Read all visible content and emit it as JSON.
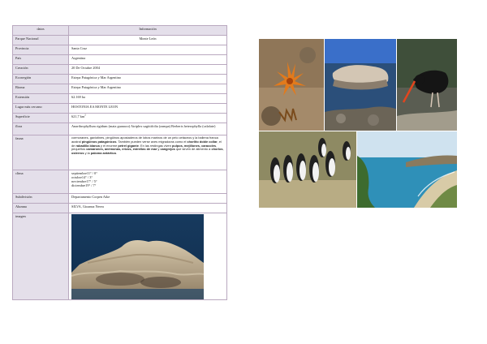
{
  "table": {
    "header": {
      "left": "datos",
      "right": "Información"
    },
    "rows": [
      {
        "key": "Parque Nacional",
        "value": "Monte León",
        "center": true
      },
      {
        "key": "Provincia",
        "value": "Santa Cruz"
      },
      {
        "key": "País",
        "value": "Argentina"
      },
      {
        "key": "Creación",
        "value": "20 De Octubre 2004"
      },
      {
        "key": "Ecorregión",
        "value": "Estepa Patagónica y Mar Argentino"
      },
      {
        "key": "Bioma",
        "value": "Estepa Patagónica y Mar Argentino"
      },
      {
        "key": "Extensión",
        "value": "62.169 ha"
      },
      {
        "key": "Lugar más cercano",
        "value": "HOSTONIA EA MONTE LEON"
      }
    ],
    "superficie": {
      "key": "Superficie",
      "value": "621,7 km",
      "sup": "2"
    },
    "flora": {
      "key": "flora",
      "value": "Anarthrophyllum rigidum (mata guanaco) Atriplex sagittifolia (zampa) Berberis heterophylla (calafate)"
    },
    "fauna": {
      "key": "fauna",
      "p1": "cormoranes, gaviotines, pingüinos apostaderos de lobos marinos de un pelo cetáceos y la  ballena franca austral",
      "p1b": "pingüinos patagónicos",
      "p2": ". También pueden verse aves migradoras como el",
      "b1": "chorlito doble collar",
      "p3": ", el de",
      "b2": "rabadilla blanca",
      "p4": " y el enorme",
      "b3": "petrel gigante",
      "p5": ". En las restingas viven",
      "b4": "pulpos, mejillones, caracoles",
      "p6": ", pequeños",
      "b5": "camarones, anémonas, erizos, estrellas de mar",
      "p7": " y",
      "b6": "cangrejos",
      "p8": " que sirven de alimento a",
      "b7": "chorlos",
      "p9": ",",
      "b8": "ostreros",
      "p10": " y la",
      "b9": "paloma antártica",
      "p11": "."
    },
    "clima": {
      "key": "clima",
      "lines": [
        "septiembre11° / 0°",
        "octubre14° / 3°",
        "noviembre17° / 5°",
        "diciembre19° / 7°"
      ]
    },
    "tail_rows": [
      {
        "key": "Subdivisión",
        "value": "Departamento Corpen Aike"
      },
      {
        "key": "Alumna",
        "value": "SILVA, Gioanna Nerea"
      }
    ],
    "imagen": {
      "key": "imagen"
    }
  },
  "colors": {
    "label_bg": "#e4dfea",
    "border": "#b9a8bf"
  },
  "photos": [
    "flower-photo",
    "rock-sea-photo",
    "oystercatcher-photo",
    "penguins-photo",
    "coast-photo",
    "sea-lion-rock-photo"
  ]
}
